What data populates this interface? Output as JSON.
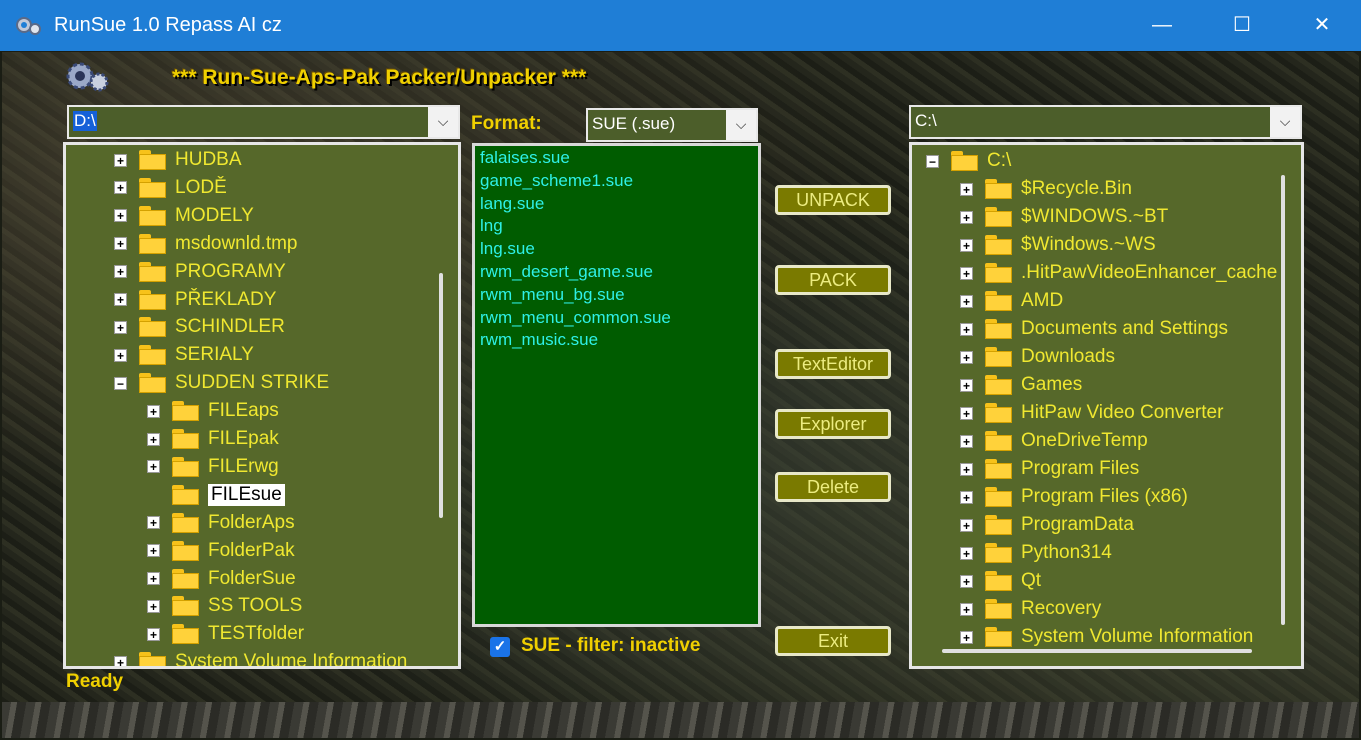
{
  "window": {
    "title": "RunSue 1.0 Repass AI cz",
    "minimize_glyph": "—",
    "maximize_glyph": "☐",
    "close_glyph": "✕"
  },
  "header": {
    "app_title": "*** Run-Sue-Aps-Pak Packer/Unpacker ***"
  },
  "left_panel": {
    "drive_value": "D:\\",
    "tree": [
      {
        "label": "HUDBA",
        "expander": "+",
        "level": 0
      },
      {
        "label": "LODĚ",
        "expander": "+",
        "level": 0
      },
      {
        "label": "MODELY",
        "expander": "+",
        "level": 0
      },
      {
        "label": "msdownld.tmp",
        "expander": "+",
        "level": 0
      },
      {
        "label": "PROGRAMY",
        "expander": "+",
        "level": 0
      },
      {
        "label": "PŘEKLADY",
        "expander": "+",
        "level": 0
      },
      {
        "label": "SCHINDLER",
        "expander": "+",
        "level": 0
      },
      {
        "label": "SERIALY",
        "expander": "+",
        "level": 0
      },
      {
        "label": "SUDDEN STRIKE",
        "expander": "−",
        "level": 0
      },
      {
        "label": "FILEaps",
        "expander": "+",
        "level": 1
      },
      {
        "label": "FILEpak",
        "expander": "+",
        "level": 1
      },
      {
        "label": "FILErwg",
        "expander": "+",
        "level": 1
      },
      {
        "label": "FILEsue",
        "expander": "",
        "level": 1,
        "selected": true
      },
      {
        "label": "FolderAps",
        "expander": "+",
        "level": 1
      },
      {
        "label": "FolderPak",
        "expander": "+",
        "level": 1
      },
      {
        "label": "FolderSue",
        "expander": "+",
        "level": 1
      },
      {
        "label": "SS TOOLS",
        "expander": "+",
        "level": 1
      },
      {
        "label": "TESTfolder",
        "expander": "+",
        "level": 1
      },
      {
        "label": "System Volume Information",
        "expander": "+",
        "level": 0
      }
    ]
  },
  "middle_panel": {
    "format_label": "Format:",
    "format_value": "SUE (.sue)",
    "files": [
      "falaises.sue",
      "game_scheme1.sue",
      "lang.sue",
      "lng",
      "lng.sue",
      "rwm_desert_game.sue",
      "rwm_menu_bg.sue",
      "rwm_menu_common.sue",
      "rwm_music.sue"
    ],
    "filter_label": "SUE - filter: inactive",
    "filter_checked": true
  },
  "buttons": {
    "unpack": "UNPACK",
    "pack": "PACK",
    "text_editor": "TextEditor",
    "explorer": "Explorer",
    "delete": "Delete",
    "exit": "Exit"
  },
  "right_panel": {
    "drive_value": "C:\\",
    "tree": [
      {
        "label": "C:\\",
        "expander": "−",
        "level": 0
      },
      {
        "label": "$Recycle.Bin",
        "expander": "+",
        "level": 1
      },
      {
        "label": "$WINDOWS.~BT",
        "expander": "+",
        "level": 1
      },
      {
        "label": "$Windows.~WS",
        "expander": "+",
        "level": 1
      },
      {
        "label": ".HitPawVideoEnhancer_cache",
        "expander": "+",
        "level": 1
      },
      {
        "label": "AMD",
        "expander": "+",
        "level": 1
      },
      {
        "label": "Documents and Settings",
        "expander": "+",
        "level": 1
      },
      {
        "label": "Downloads",
        "expander": "+",
        "level": 1
      },
      {
        "label": "Games",
        "expander": "+",
        "level": 1
      },
      {
        "label": "HitPaw Video Converter",
        "expander": "+",
        "level": 1
      },
      {
        "label": "OneDriveTemp",
        "expander": "+",
        "level": 1
      },
      {
        "label": "Program Files",
        "expander": "+",
        "level": 1
      },
      {
        "label": "Program Files (x86)",
        "expander": "+",
        "level": 1
      },
      {
        "label": "ProgramData",
        "expander": "+",
        "level": 1
      },
      {
        "label": "Python314",
        "expander": "+",
        "level": 1
      },
      {
        "label": "Qt",
        "expander": "+",
        "level": 1
      },
      {
        "label": "Recovery",
        "expander": "+",
        "level": 1
      },
      {
        "label": "System Volume Information",
        "expander": "+",
        "level": 1
      }
    ]
  },
  "status": {
    "text": "Ready"
  },
  "colors": {
    "accent": "#f0d000",
    "panel": "#56682a",
    "filelist_bg": "#005c00",
    "file_text": "#2ef0e6",
    "button": "#7a7a00"
  },
  "icons": {
    "app": "gear-icon",
    "folder": "folder-icon",
    "checkbox": "checkbox-checked-icon"
  }
}
